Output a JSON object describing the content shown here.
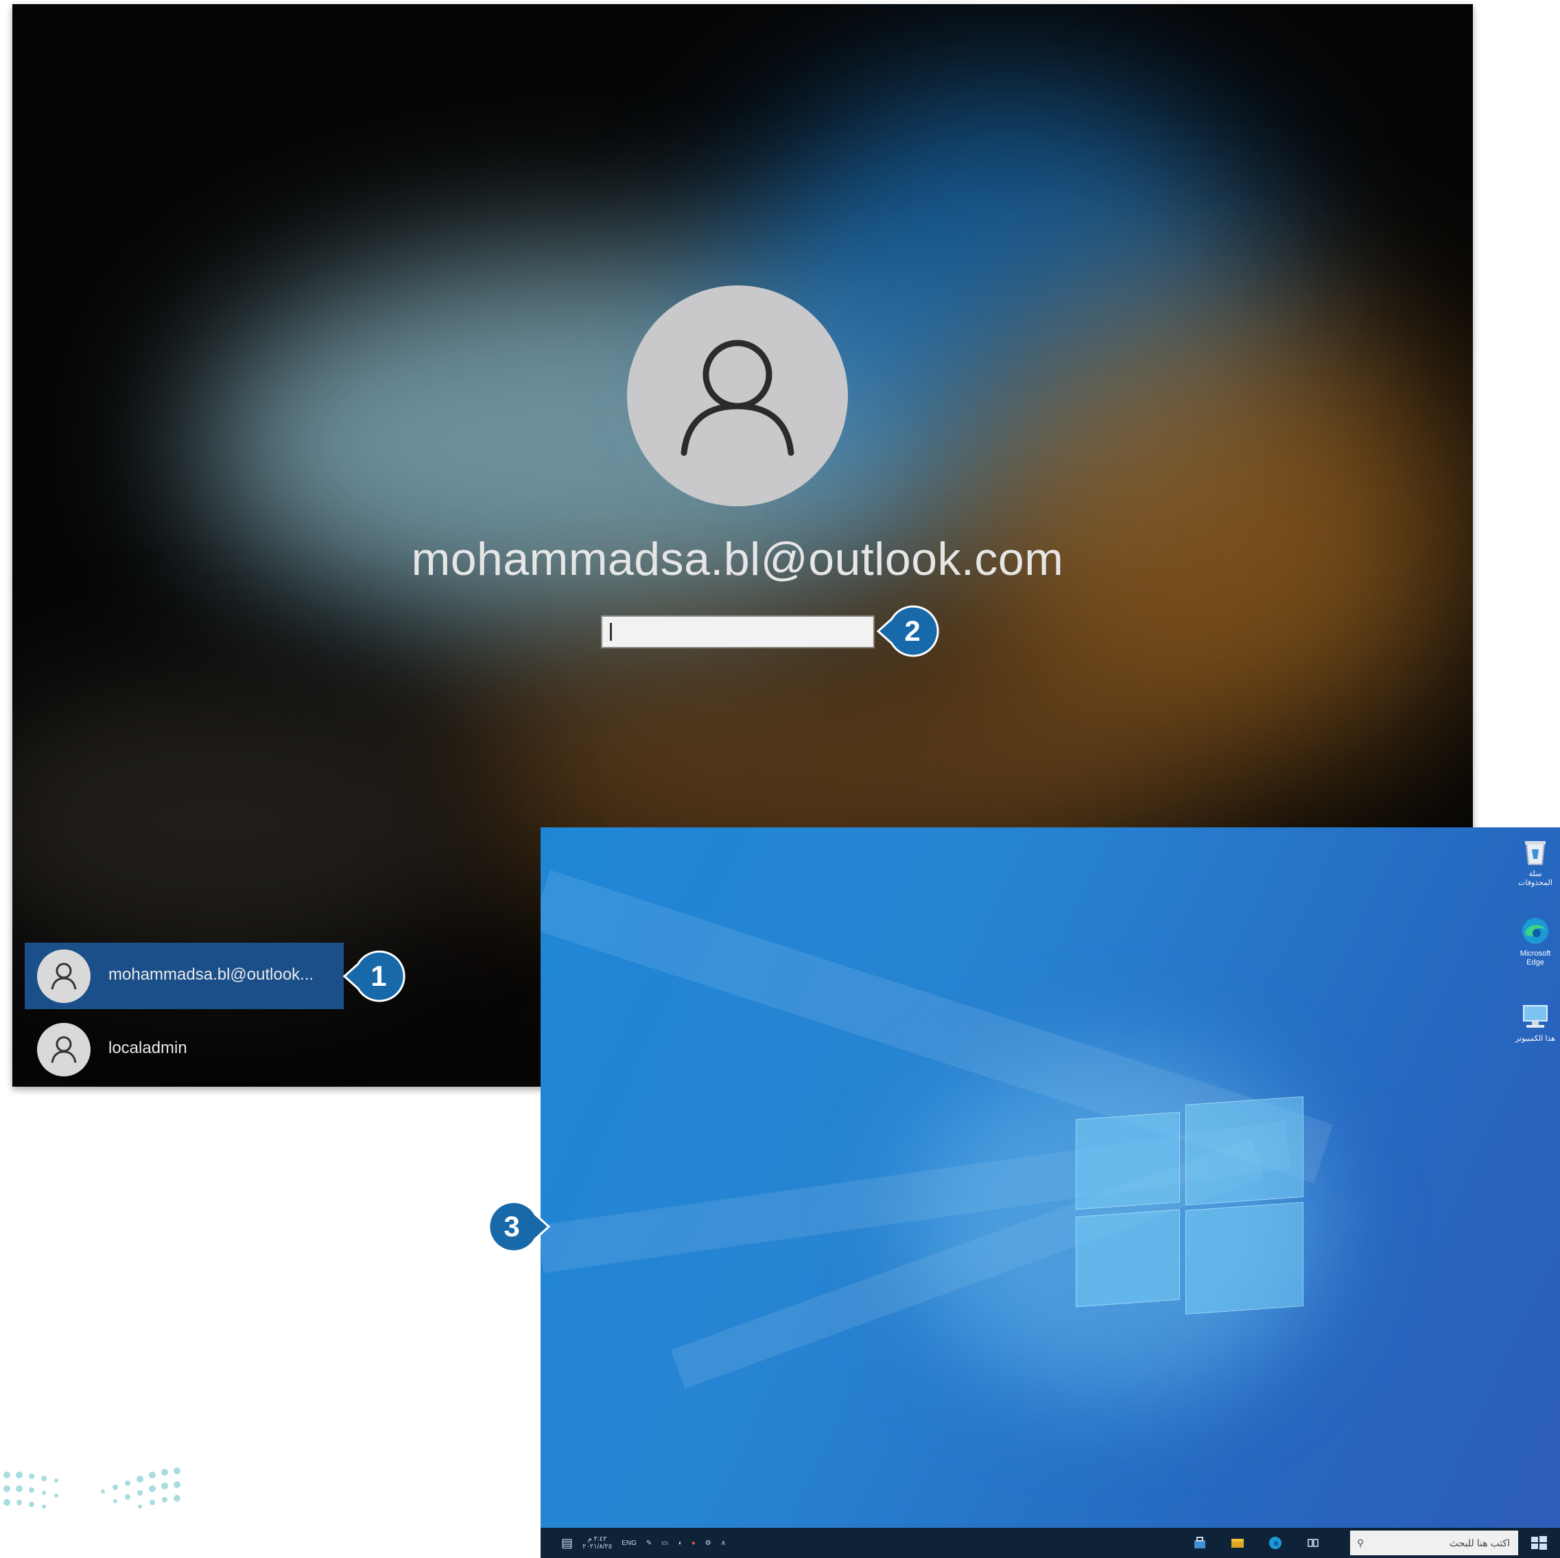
{
  "lock_screen": {
    "user_email": "mohammadsa.bl@outlook.com",
    "password": {
      "value": "",
      "placeholder": ""
    },
    "user_list": [
      {
        "label": "mohammadsa.bl@outlook...",
        "selected": true
      },
      {
        "label": "localadmin",
        "selected": false
      }
    ]
  },
  "callouts": [
    "1",
    "2",
    "3"
  ],
  "desktop": {
    "icons": [
      {
        "name": "recycle-bin",
        "caption": "سلة المحذوفات"
      },
      {
        "name": "microsoft-edge",
        "caption": "Microsoft Edge"
      },
      {
        "name": "this-pc",
        "caption": "هذا الكمبيوتر"
      }
    ],
    "taskbar": {
      "search_placeholder": "اكتب هنا للبحث",
      "time": "٢:٤٢ م",
      "date": "٢٠٢١/٨/٢٥",
      "language": "ENG"
    }
  },
  "colors": {
    "callout": "#1769aa",
    "selected_user": "#1b4f8a",
    "desktop_blue": "#2784d2",
    "taskbar": "#0f2338"
  }
}
